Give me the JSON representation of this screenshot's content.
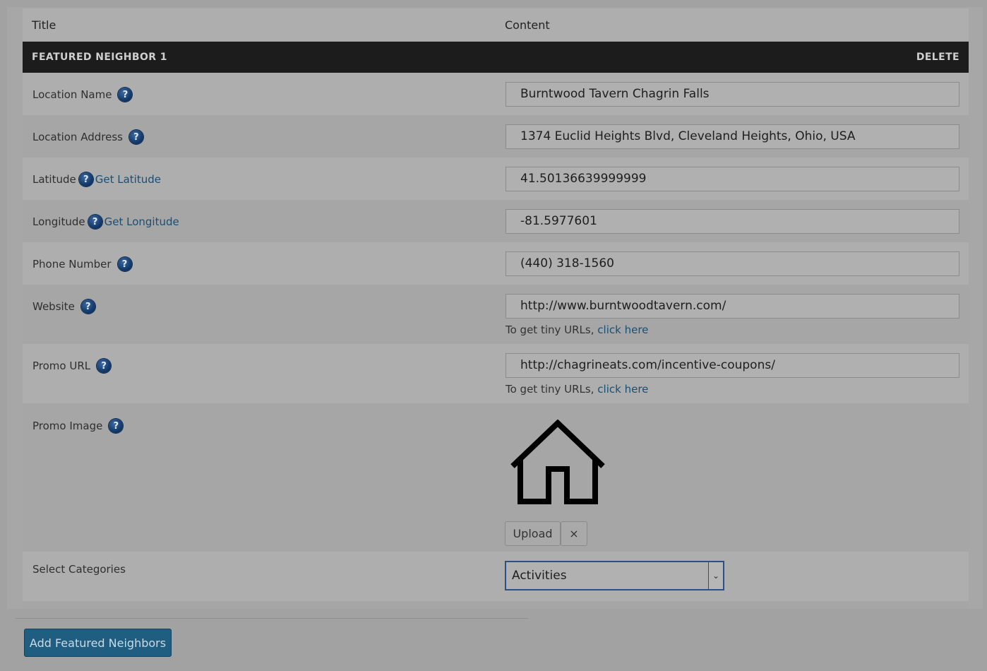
{
  "header": {
    "title_col": "Title",
    "content_col": "Content"
  },
  "neighbor": {
    "heading": "FEATURED NEIGHBOR 1",
    "delete_label": "DELETE",
    "fields": {
      "location_name": {
        "label": "Location Name",
        "value": "Burntwood Tavern Chagrin Falls"
      },
      "location_address": {
        "label": "Location Address",
        "value": "1374 Euclid Heights Blvd, Cleveland Heights, Ohio, USA"
      },
      "latitude": {
        "label": "Latitude",
        "link": "Get Latitude",
        "value": "41.50136639999999"
      },
      "longitude": {
        "label": "Longitude",
        "link": "Get Longitude",
        "value": "-81.5977601"
      },
      "phone": {
        "label": "Phone Number",
        "value": "(440) 318-1560"
      },
      "website": {
        "label": "Website",
        "value": "http://www.burntwoodtavern.com/",
        "note_prefix": "To get tiny URLs,",
        "note_link": "click here"
      },
      "promo_url": {
        "label": "Promo URL",
        "value": "http://chagrineats.com/incentive-coupons/",
        "note_prefix": "To get tiny URLs,",
        "note_link": "click here"
      },
      "promo_image": {
        "label": "Promo Image",
        "image_icon": "house-icon",
        "upload_label": "Upload",
        "remove_label": "×"
      },
      "categories": {
        "label": "Select Categories",
        "selected": "Activities"
      }
    }
  },
  "footer": {
    "add_button": "Add Featured Neighbors"
  },
  "colors": {
    "accent": "#1f5e80",
    "bar": "#1c1c1c",
    "link": "#1a4f73",
    "help": "#123a6b"
  }
}
